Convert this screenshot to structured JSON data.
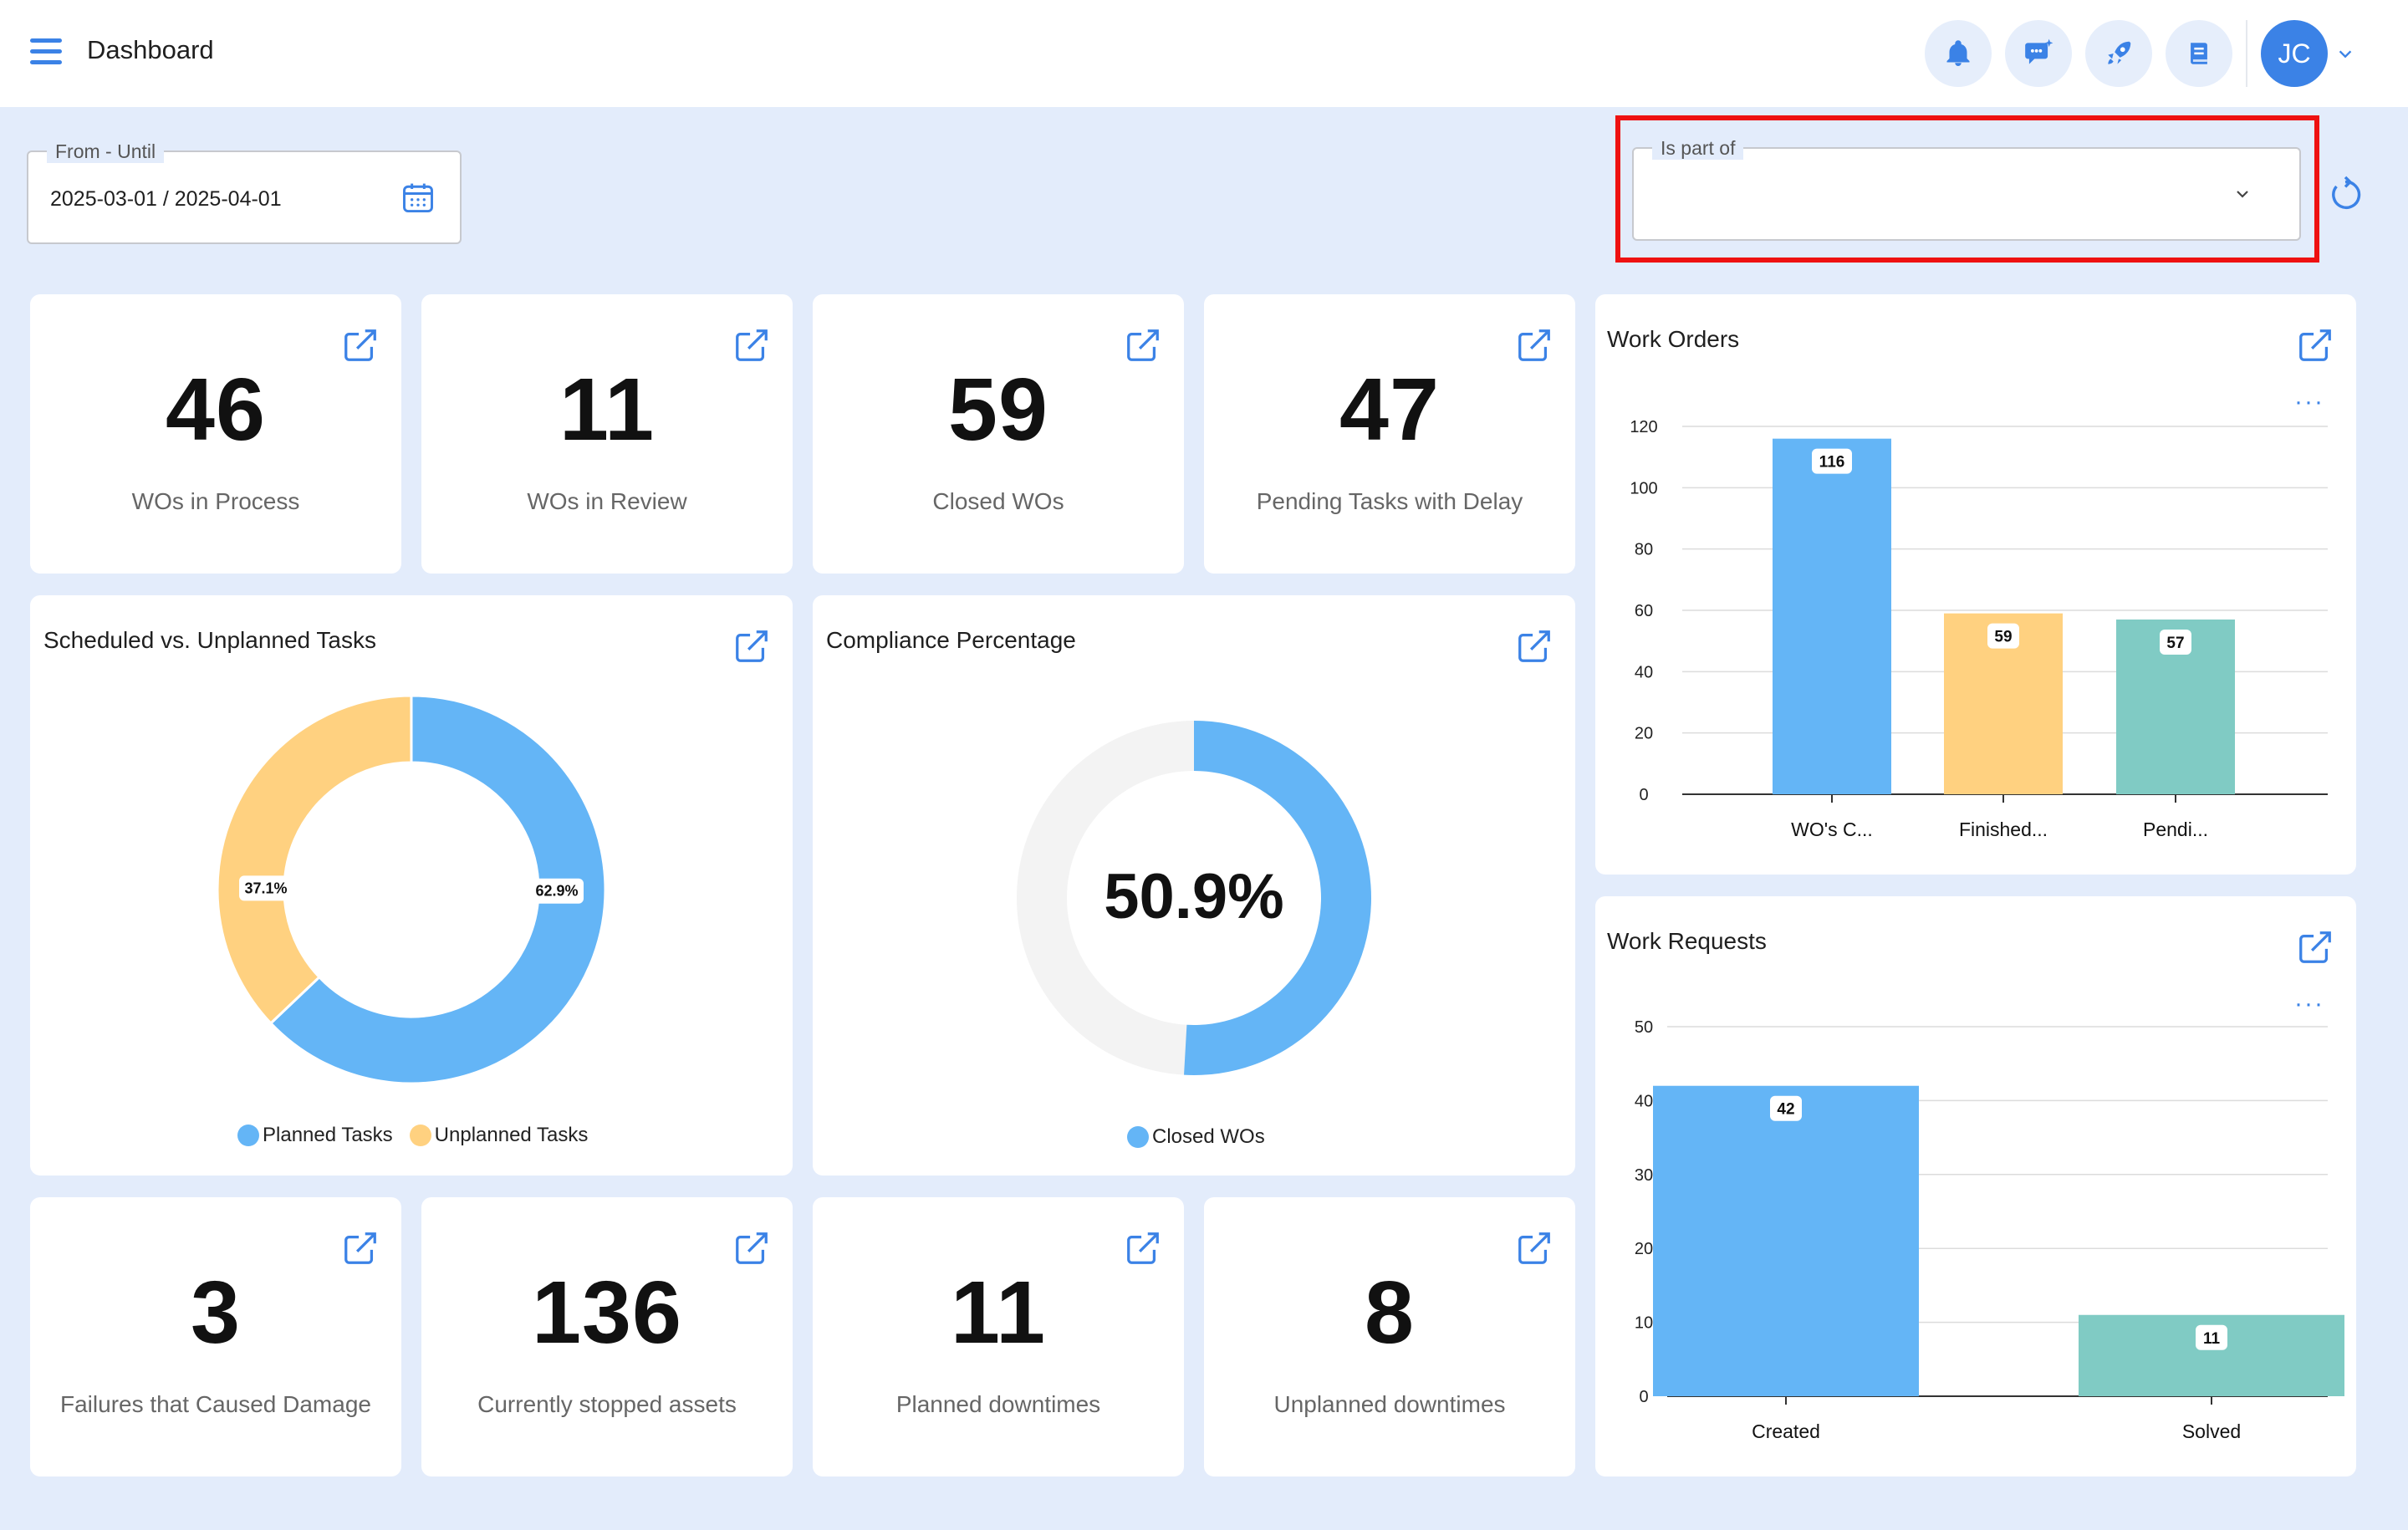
{
  "header": {
    "title": "Dashboard",
    "avatar_initials": "JC"
  },
  "filters": {
    "date_label": "From - Until",
    "date_value": "2025-03-01 / 2025-04-01",
    "part_of_label": "Is part of",
    "part_of_value": ""
  },
  "kpis_top": [
    {
      "value": "46",
      "label": "WOs in Process"
    },
    {
      "value": "11",
      "label": "WOs in Review"
    },
    {
      "value": "59",
      "label": "Closed WOs"
    },
    {
      "value": "47",
      "label": "Pending Tasks with Delay"
    }
  ],
  "kpis_bottom": [
    {
      "value": "3",
      "label": "Failures that Caused Damage"
    },
    {
      "value": "136",
      "label": "Currently stopped assets"
    },
    {
      "value": "11",
      "label": "Planned downtimes"
    },
    {
      "value": "8",
      "label": "Unplanned downtimes"
    }
  ],
  "colors": {
    "blue": "#64b5f6",
    "yellow": "#ffd180",
    "teal": "#80cbc4",
    "accent": "#3b82e6",
    "track": "#f3f3f3"
  },
  "chart_data": [
    {
      "type": "pie",
      "title": "Scheduled vs. Unplanned Tasks",
      "categories": [
        "Planned Tasks",
        "Unplanned Tasks"
      ],
      "values": [
        62.9,
        37.1
      ],
      "labels": [
        "62.9%",
        "37.1%"
      ],
      "legend": "bottom"
    },
    {
      "type": "pie",
      "title": "Compliance Percentage",
      "categories": [
        "Closed WOs"
      ],
      "values": [
        50.9
      ],
      "center_label": "50.9%",
      "legend": "bottom"
    },
    {
      "type": "bar",
      "title": "Work Orders",
      "categories": [
        "WO's C...",
        "Finished...",
        "Pendi..."
      ],
      "values": [
        116,
        59,
        57
      ],
      "ylim": [
        0,
        120
      ],
      "yticks": [
        0,
        20,
        40,
        60,
        80,
        100,
        120
      ],
      "grid": true
    },
    {
      "type": "bar",
      "title": "Work Requests",
      "categories": [
        "Created",
        "Solved"
      ],
      "values": [
        42,
        11
      ],
      "ylim": [
        0,
        50
      ],
      "yticks": [
        0,
        10,
        20,
        30,
        40,
        50
      ],
      "grid": true
    }
  ]
}
